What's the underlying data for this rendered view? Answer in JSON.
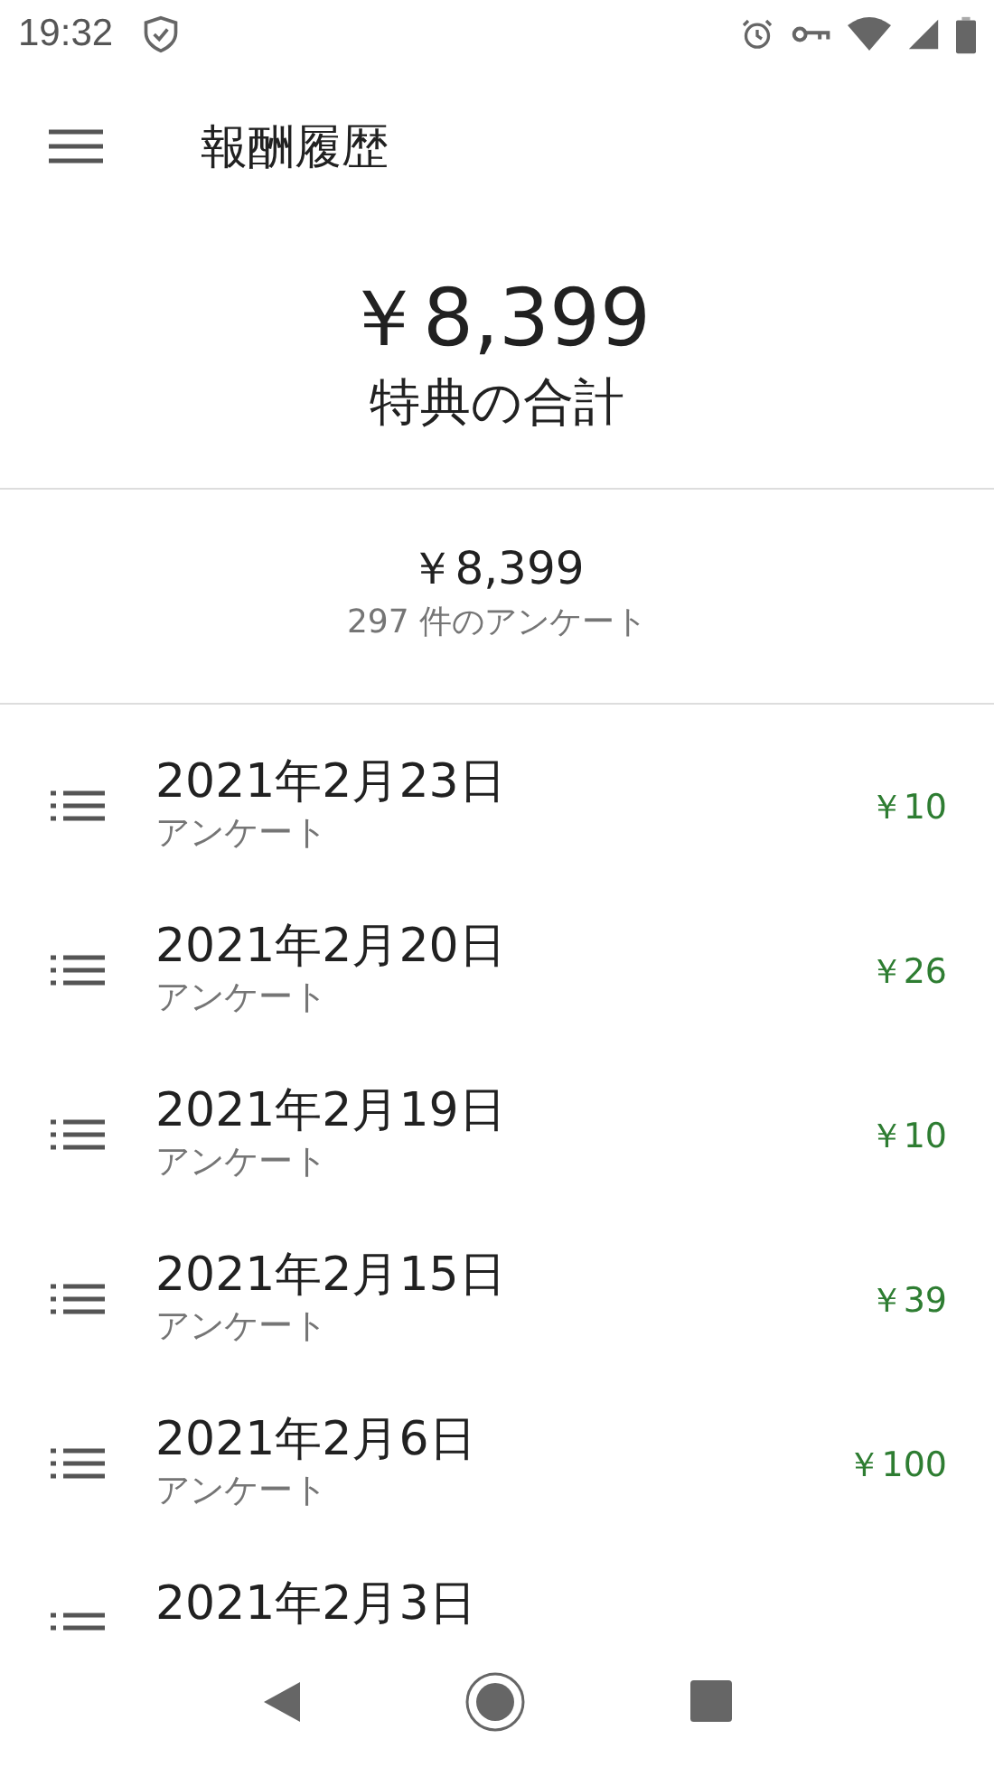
{
  "status_bar": {
    "time": "19:32"
  },
  "app_bar": {
    "title": "報酬履歴"
  },
  "total": {
    "amount": "￥8,399",
    "label": "特典の合計"
  },
  "summary": {
    "amount": "￥8,399",
    "count": "297 件のアンケート"
  },
  "rewards": [
    {
      "date": "2021年2月23日",
      "type": "アンケート",
      "amount": "￥10"
    },
    {
      "date": "2021年2月20日",
      "type": "アンケート",
      "amount": "￥26"
    },
    {
      "date": "2021年2月19日",
      "type": "アンケート",
      "amount": "￥10"
    },
    {
      "date": "2021年2月15日",
      "type": "アンケート",
      "amount": "￥39"
    },
    {
      "date": "2021年2月6日",
      "type": "アンケート",
      "amount": "￥100"
    },
    {
      "date": "2021年2月3日"
    }
  ]
}
